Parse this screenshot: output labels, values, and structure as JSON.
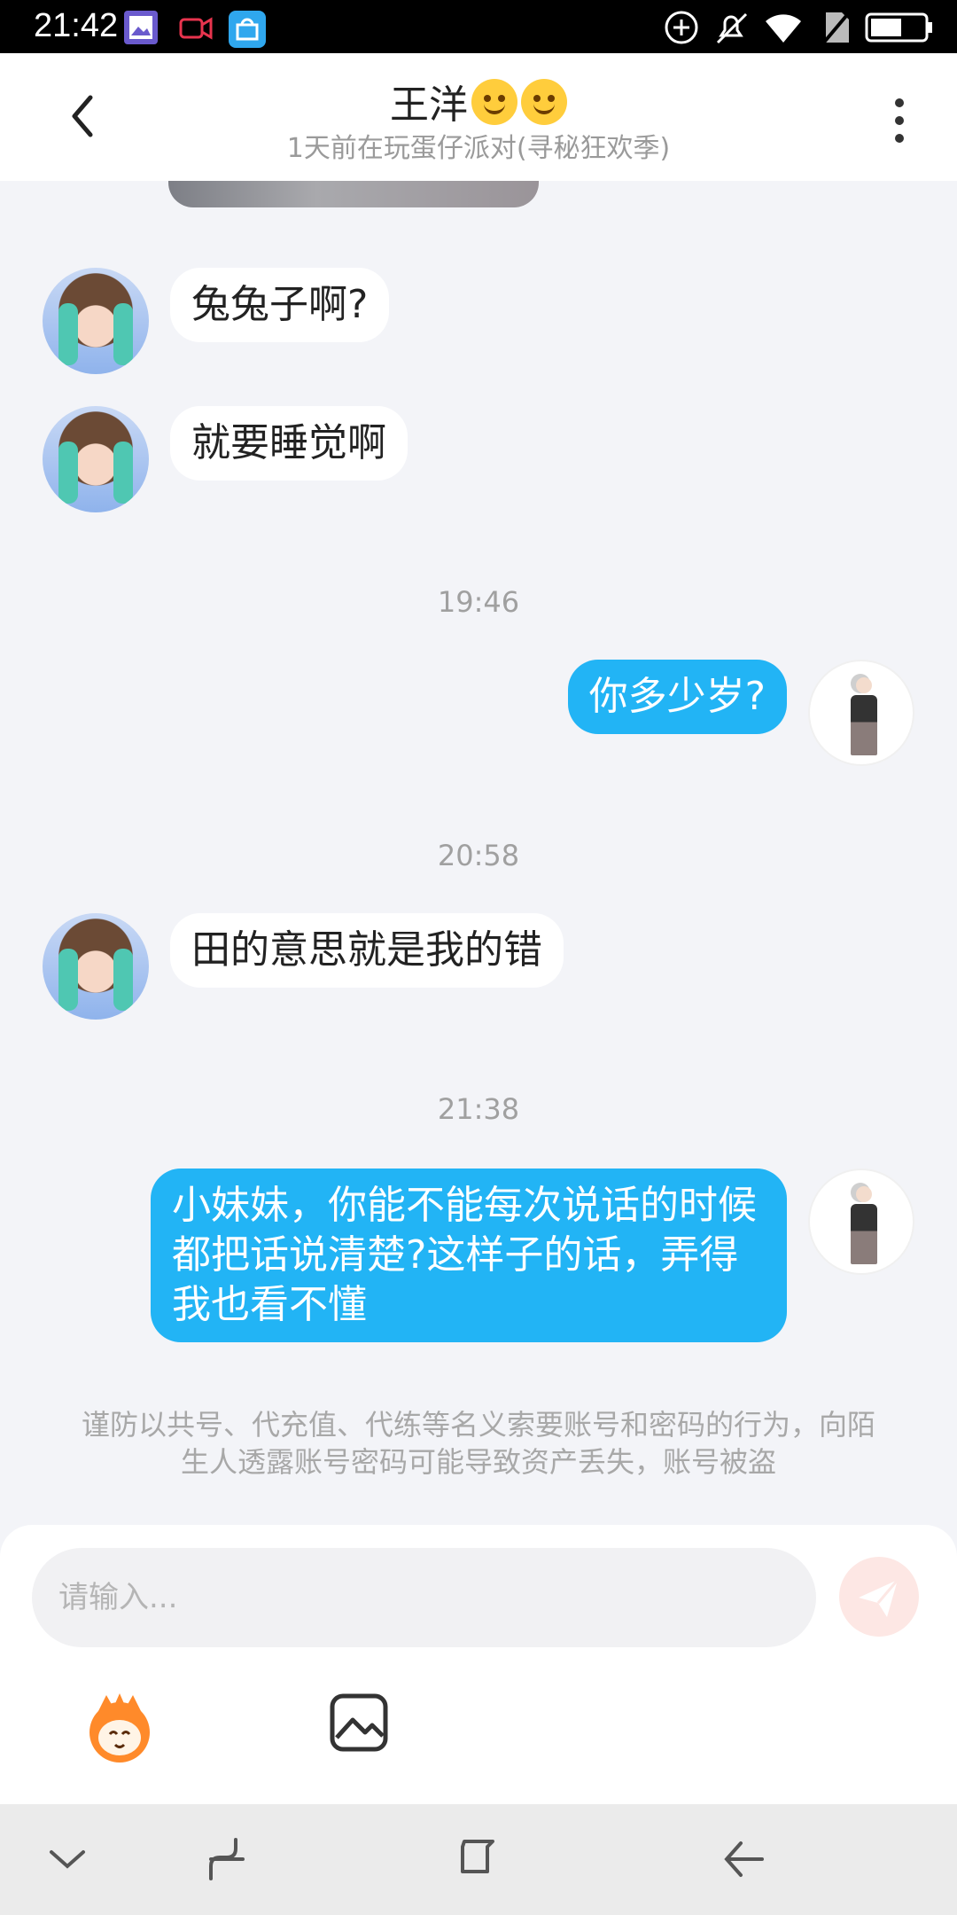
{
  "status_bar": {
    "time": "21:42",
    "icons": [
      "gallery-icon",
      "screen-record-icon",
      "koobee-store-icon",
      "add-circle-icon",
      "bell-off-icon",
      "wifi-icon",
      "no-sim-icon",
      "battery-icon"
    ]
  },
  "header": {
    "contact_name": "王洋",
    "subtitle": "1天前在玩蛋仔派对(寻秘狂欢季)",
    "back_icon": "chevron-left-icon",
    "more_icon": "more-vertical-icon"
  },
  "messages": [
    {
      "side": "in",
      "text": "兔兔子啊?"
    },
    {
      "side": "in",
      "text": "就要睡觉啊"
    },
    {
      "type": "time",
      "text": "19:46"
    },
    {
      "side": "out",
      "text": "你多少岁?"
    },
    {
      "type": "time",
      "text": "20:58"
    },
    {
      "side": "in",
      "text": "田的意思就是我的错"
    },
    {
      "type": "time",
      "text": "21:38"
    },
    {
      "side": "out",
      "text": "小妹妹，你能不能每次说话的时候都把话说清楚?这样子的话，弄得我也看不懂"
    }
  ],
  "notice": "谨防以共号、代充值、代练等名义索要账号和密码的行为，向陌生人透露账号密码可能导致资产丢失，账号被盗",
  "input": {
    "placeholder": "请输入...",
    "value": ""
  },
  "colors": {
    "outgoing_bubble": "#22b4f5",
    "incoming_bubble": "#ffffff",
    "chat_background": "#f3f4f8",
    "send_button": "#fde7e4"
  }
}
